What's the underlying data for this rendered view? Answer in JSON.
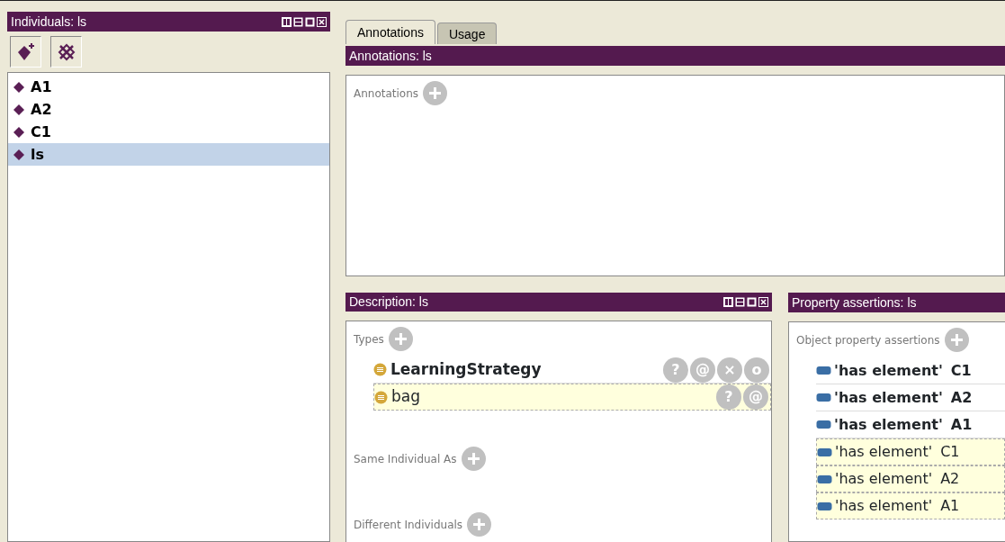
{
  "individuals_panel": {
    "title": "Individuals: ls",
    "items": [
      {
        "label": "A1",
        "selected": false
      },
      {
        "label": "A2",
        "selected": false
      },
      {
        "label": "C1",
        "selected": false
      },
      {
        "label": "ls",
        "selected": true
      }
    ]
  },
  "tabs": [
    {
      "label": "Annotations",
      "selected": true
    },
    {
      "label": "Usage",
      "selected": false
    }
  ],
  "annotations_panel": {
    "title": "Annotations: ls",
    "section": "Annotations"
  },
  "description_panel": {
    "title": "Description: ls",
    "sections": [
      {
        "label": "Types",
        "rows": [
          {
            "label": "LearningStrategy",
            "inferred": false,
            "buttons": [
              "?",
              "@",
              "×",
              "o"
            ]
          },
          {
            "label": "bag",
            "inferred": true,
            "buttons": [
              "?",
              "@"
            ]
          }
        ]
      },
      {
        "label": "Same Individual As"
      },
      {
        "label": "Different Individuals"
      }
    ]
  },
  "property_panel": {
    "title": "Property assertions: ls",
    "section": "Object property assertions",
    "rows": [
      {
        "property": "'has element'",
        "value": "C1",
        "inferred": false
      },
      {
        "property": "'has element'",
        "value": "A2",
        "inferred": false
      },
      {
        "property": "'has element'",
        "value": "A1",
        "inferred": false
      },
      {
        "property": "'has element'",
        "value": "C1",
        "inferred": true
      },
      {
        "property": "'has element'",
        "value": "A2",
        "inferred": true
      },
      {
        "property": "'has element'",
        "value": "A1",
        "inferred": true
      }
    ]
  }
}
